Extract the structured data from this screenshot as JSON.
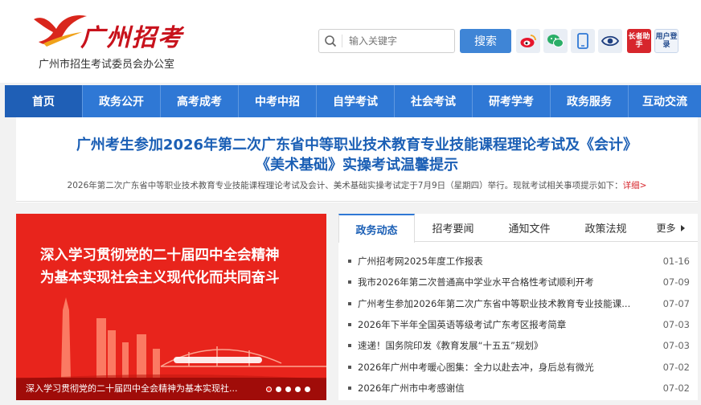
{
  "header": {
    "logo_text": "广州招考",
    "org_name": "广州市招生考试委员会办公室",
    "search_placeholder": "输入关键字",
    "search_button": "搜索",
    "elder_helper": "长者助手",
    "user_login": "用户登录"
  },
  "nav": {
    "items": [
      "首页",
      "政务公开",
      "高考成考",
      "中考中招",
      "自学考试",
      "社会考试",
      "研考学考",
      "政务服务",
      "互动交流"
    ]
  },
  "headline": {
    "title_line1": "广州考生参加2026年第二次广东省中等职业技术教育专业技能课程理论考试及《会计》",
    "title_line2": "《美术基础》实操考试温馨提示",
    "summary": "2026年第二次广东省中等职业技术教育专业技能课程理论考试及会计、美术基础实操考试定于7月9日（星期四）举行。现就考试相关事项提示如下：",
    "more_label": "详细>"
  },
  "banner": {
    "line1": "深入学习贯彻党的二十届四中全会精神",
    "line2": "为基本实现社会主义现代化而共同奋斗",
    "caption": "深入学习贯彻党的二十届四中全会精神为基本实现社..."
  },
  "news": {
    "tabs": [
      "政务动态",
      "招考要闻",
      "通知文件",
      "政策法规"
    ],
    "more_label": "更多",
    "items": [
      {
        "title": "广州招考网2025年度工作报表",
        "date": "01-16"
      },
      {
        "title": "我市2026年第二次普通高中学业水平合格性考试顺利开考",
        "date": "07-09"
      },
      {
        "title": "广州考生参加2026年第二次广东省中等职业技术教育专业技能课...",
        "date": "07-07"
      },
      {
        "title": "2026年下半年全国英语等级考试广东考区报考简章",
        "date": "07-03"
      },
      {
        "title": "速递！国务院印发《教育发展“十五五”规划》",
        "date": "07-03"
      },
      {
        "title": "2026年广州中考暖心图集：全力以赴去冲，身后总有微光",
        "date": "07-02"
      },
      {
        "title": "2026年广州市中考感谢信",
        "date": "07-02"
      }
    ]
  }
}
